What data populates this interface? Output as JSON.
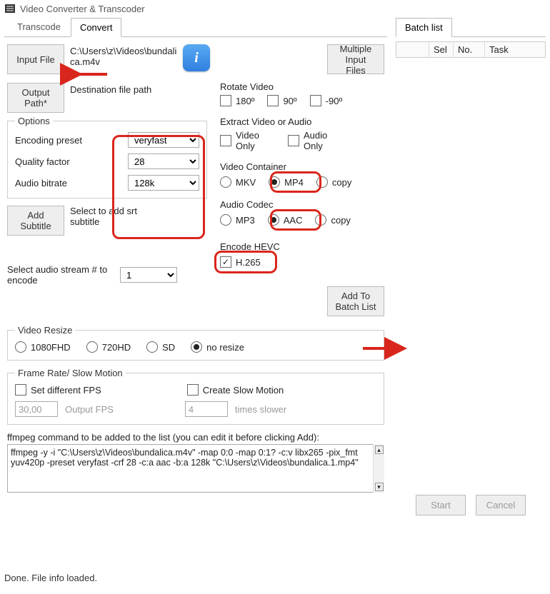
{
  "window": {
    "title": "Video Converter & Transcoder"
  },
  "tabs": {
    "transcode": "Transcode",
    "convert": "Convert",
    "batch": "Batch list"
  },
  "buttons": {
    "input_file": "Input File",
    "output_path": "Output\nPath*",
    "multiple_input": "Multiple\nInput Files",
    "add_subtitle": "Add\nSubtitle",
    "add_to_batch": "Add To\nBatch List",
    "start": "Start",
    "cancel": "Cancel"
  },
  "labels": {
    "input_path": "C:\\Users\\z\\Videos\\bundalica.m4v",
    "dest_path": "Destination file path",
    "options": "Options",
    "encoding_preset": "Encoding preset",
    "quality_factor": "Quality factor",
    "audio_bitrate": "Audio bitrate",
    "subtitle_hint": "Select to add srt subtitle",
    "rotate_video": "Rotate Video",
    "rot180": "180º",
    "rot90": "90º",
    "rotm90": "-90º",
    "extract": "Extract Video or Audio",
    "video_only": "Video\nOnly",
    "audio_only": "Audio\nOnly",
    "video_container": "Video Container",
    "mkv": "MKV",
    "mp4": "MP4",
    "copy": "copy",
    "audio_codec": "Audio Codec",
    "mp3": "MP3",
    "aac": "AAC",
    "encode_hevc": "Encode HEVC",
    "h265": "H.265",
    "audio_stream": "Select audio stream # to encode",
    "video_resize": "Video Resize",
    "r1080": "1080FHD",
    "r720": "720HD",
    "rsd": "SD",
    "rnorez": "no resize",
    "framerate": "Frame Rate/ Slow Motion",
    "set_fps": "Set different FPS",
    "output_fps": "Output FPS",
    "slowmo": "Create Slow Motion",
    "times_slower": "times slower",
    "cmd_hint": "ffmpeg command to be added to the list (you can edit it before clicking Add):"
  },
  "values": {
    "preset": "veryfast",
    "quality": "28",
    "abitrate": "128k",
    "audio_stream": "1",
    "fps": "30,00",
    "slow_factor": "4",
    "ffmpeg_cmd": "ffmpeg -y -i \"C:\\Users\\z\\Videos\\bundalica.m4v\" -map 0:0 -map 0:1? -c:v libx265 -pix_fmt yuv420p -preset veryfast -crf 28  -c:a aac -b:a 128k \"C:\\Users\\z\\Videos\\bundalica.1.mp4\""
  },
  "batch_cols": {
    "blank": "",
    "sel": "Sel",
    "no": "No.",
    "task": "Task"
  },
  "status": "Done. File info loaded."
}
